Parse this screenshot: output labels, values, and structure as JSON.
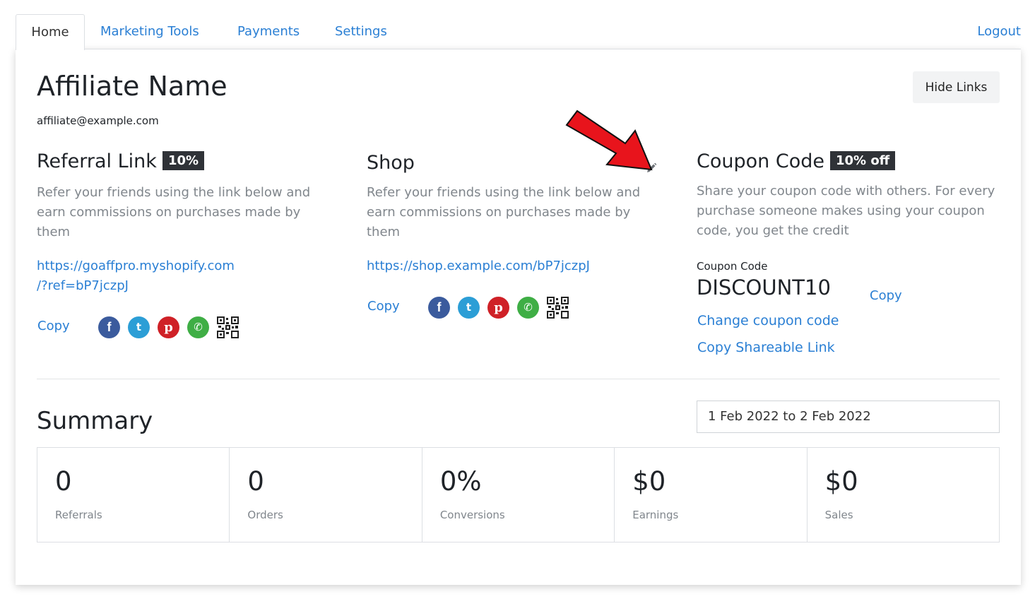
{
  "tabs": {
    "home": "Home",
    "marketing": "Marketing Tools",
    "payments": "Payments",
    "settings": "Settings",
    "logout": "Logout"
  },
  "profile": {
    "name": "Affiliate Name",
    "email": "affiliate@example.com",
    "hide_links_label": "Hide Links"
  },
  "referral": {
    "title": "Referral Link",
    "badge": "10%",
    "description": "Refer your friends using the link below and earn commissions on purchases made by them",
    "link_line1": "https://goaffpro.myshopify.com",
    "link_line2": "/?ref=bP7jczpJ",
    "copy_label": "Copy"
  },
  "shop": {
    "title": "Shop",
    "description": "Refer your friends using the link below and earn commissions on purchases made by them",
    "link": "https://shop.example.com/bP7jczpJ",
    "copy_label": "Copy"
  },
  "coupon": {
    "title": "Coupon Code",
    "badge": "10% off",
    "description": "Share your coupon code with others. For every purchase someone makes using your coupon code, you get the credit",
    "code_label": "Coupon Code",
    "code": "DISCOUNT10",
    "copy_label": "Copy",
    "change_label": "Change coupon code",
    "shareable_label": "Copy Shareable Link"
  },
  "share_icons": [
    "facebook-icon",
    "twitter-icon",
    "pinterest-icon",
    "whatsapp-icon",
    "qr-code-icon"
  ],
  "summary": {
    "title": "Summary",
    "date_range": "1 Feb 2022 to 2 Feb 2022",
    "stats": [
      {
        "value": "0",
        "label": "Referrals"
      },
      {
        "value": "0",
        "label": "Orders"
      },
      {
        "value": "0%",
        "label": "Conversions"
      },
      {
        "value": "$0",
        "label": "Earnings"
      },
      {
        "value": "$0",
        "label": "Sales"
      }
    ]
  },
  "colors": {
    "accent": "#2a7fd4",
    "badge_bg": "#2f3237",
    "annotation_arrow": "#e8141c"
  }
}
